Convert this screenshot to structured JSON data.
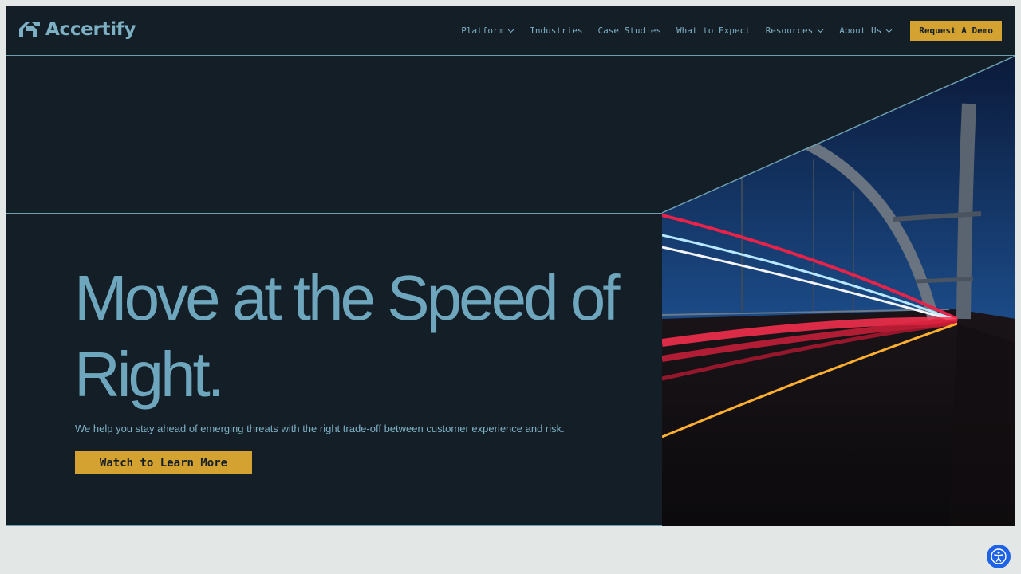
{
  "brand": {
    "name": "Accertify"
  },
  "nav": {
    "items": [
      {
        "label": "Platform",
        "dropdown": true
      },
      {
        "label": "Industries",
        "dropdown": false
      },
      {
        "label": "Case Studies",
        "dropdown": false
      },
      {
        "label": "What to Expect",
        "dropdown": false
      },
      {
        "label": "Resources",
        "dropdown": true
      },
      {
        "label": "About Us",
        "dropdown": true
      }
    ],
    "cta_label": "Request A Demo"
  },
  "hero": {
    "headline": "Move at the Speed of Right.",
    "subtext": "We help you stay ahead of emerging threats with the right trade-off between customer experience and risk.",
    "cta_label": "Watch to Learn More",
    "image_icon": "bridge-light-trails-image"
  },
  "accessibility": {
    "icon": "accessibility-icon"
  },
  "colors": {
    "background": "#141e26",
    "accent_text": "#6ea7bd",
    "border": "#6e9fb0",
    "button": "#d3a231",
    "footer_band": "#e3e8e6",
    "a11y_button": "#1e62e8"
  }
}
